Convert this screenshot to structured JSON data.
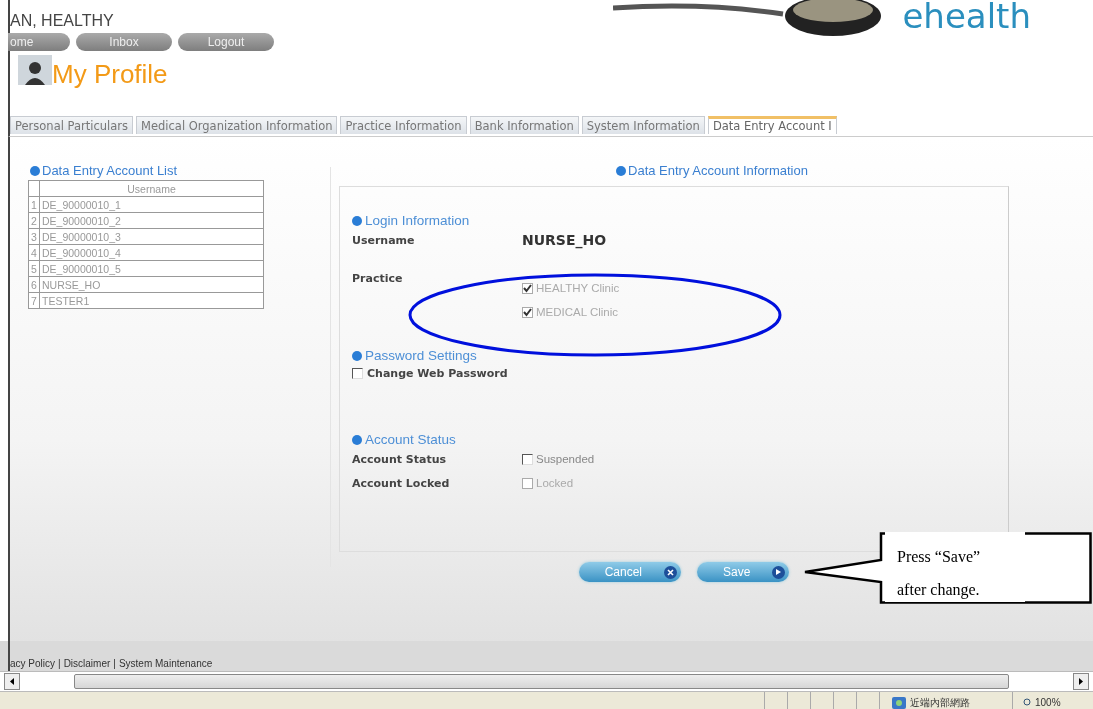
{
  "header": {
    "user_name": "AN, HEALTHY",
    "nav_buttons": [
      "ome",
      "Inbox",
      "Logout"
    ],
    "page_title": "My Profile",
    "logo": "ehealth"
  },
  "tabs": [
    {
      "label": "Personal Particulars",
      "selected": false
    },
    {
      "label": "Medical Organization Information",
      "selected": false
    },
    {
      "label": "Practice Information",
      "selected": false
    },
    {
      "label": "Bank Information",
      "selected": false
    },
    {
      "label": "System Information",
      "selected": false
    },
    {
      "label": "Data Entry Account I",
      "selected": true
    }
  ],
  "account_list": {
    "title": "Data Entry Account List",
    "column": "Username",
    "rows": [
      {
        "index": "1",
        "username": "DE_90000010_1"
      },
      {
        "index": "2",
        "username": "DE_90000010_2"
      },
      {
        "index": "3",
        "username": "DE_90000010_3"
      },
      {
        "index": "4",
        "username": "DE_90000010_4"
      },
      {
        "index": "5",
        "username": "DE_90000010_5"
      },
      {
        "index": "6",
        "username": "NURSE_HO"
      },
      {
        "index": "7",
        "username": "TESTER1"
      }
    ]
  },
  "account_info": {
    "title": "Data Entry Account Information",
    "sections": [
      {
        "title": "Login Information",
        "fields": [
          {
            "kind": "text",
            "label": "Username",
            "value": "NURSE_HO"
          },
          {
            "kind": "checks",
            "label": "Practice",
            "options": [
              {
                "label": "HEALTHY Clinic",
                "checked": true,
                "disabled": true
              },
              {
                "label": "MEDICAL Clinic",
                "checked": true,
                "disabled": true
              }
            ]
          }
        ]
      },
      {
        "title": "Password Settings",
        "fields": [
          {
            "kind": "check",
            "label": "Change Web Password",
            "checked": false
          }
        ]
      },
      {
        "title": "Account Status",
        "fields": [
          {
            "kind": "checks",
            "label": "Account Status",
            "options": [
              {
                "label": "Suspended",
                "checked": false,
                "disabled": false
              }
            ]
          },
          {
            "kind": "checks",
            "label": "Account Locked",
            "options": [
              {
                "label": "Locked",
                "checked": false,
                "disabled": true
              }
            ]
          }
        ]
      }
    ],
    "buttons": [
      {
        "kind": "cancel",
        "label": "Cancel"
      },
      {
        "kind": "save",
        "label": "Save"
      }
    ]
  },
  "callout": {
    "text": "Press “Save” after change."
  },
  "footer": {
    "links": [
      "acy Policy",
      "Disclaimer",
      "System Maintenance"
    ],
    "separator": "|"
  },
  "status_bar": {
    "zone": "近端內部網路",
    "zoom": "100%"
  }
}
